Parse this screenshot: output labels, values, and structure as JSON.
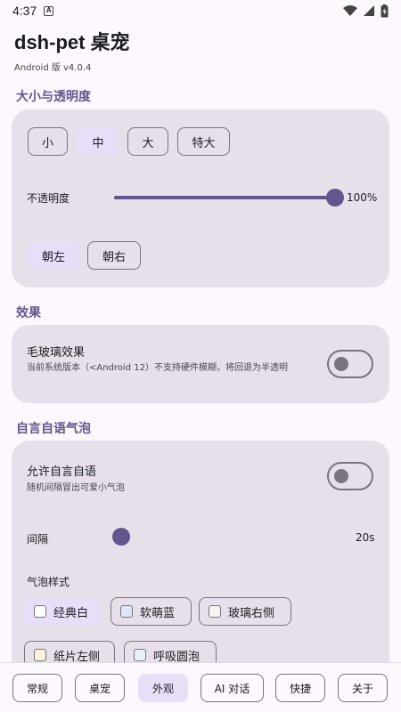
{
  "status": {
    "time": "4:37",
    "notif_glyph": "A"
  },
  "header": {
    "title": "dsh-pet 桌宠",
    "version": "Android 版 v4.0.4"
  },
  "size_section": {
    "title": "大小与透明度",
    "sizes": [
      "小",
      "中",
      "大",
      "特大"
    ],
    "selected_size": "中",
    "opacity_label": "不透明度",
    "opacity_value": "100%",
    "opacity_level": 1.0,
    "directions": [
      "朝左",
      "朝右"
    ],
    "selected_direction": "朝左"
  },
  "effect_section": {
    "title": "效果",
    "glass_label": "毛玻璃效果",
    "glass_desc": "当前系统版本（<Android 12）不支持硬件模糊，将回退为半透明",
    "glass_enabled": false
  },
  "bubble_section": {
    "title": "自言自语气泡",
    "allow_label": "允许自言自语",
    "allow_desc": "随机间隔冒出可爱小气泡",
    "allow_enabled": false,
    "interval_label": "间隔",
    "interval_value": "20s",
    "interval_level": 0.0,
    "style_label": "气泡样式",
    "styles": [
      {
        "label": "经典白",
        "color": "#ffffff"
      },
      {
        "label": "软萌蓝",
        "color": "#dbe6f7"
      },
      {
        "label": "玻璃右侧",
        "color": "#f7f3f3"
      },
      {
        "label": "纸片左侧",
        "color": "#fbf3dc"
      },
      {
        "label": "呼吸圆泡",
        "color": "#e6f1fa"
      }
    ],
    "selected_style": "经典白"
  },
  "nav": {
    "items": [
      "常规",
      "桌宠",
      "外观",
      "AI 对话",
      "快捷",
      "关于"
    ],
    "selected": "外观"
  },
  "colors": {
    "accent": "#65558f",
    "card": "#e7e0eb",
    "selected": "#e8def8"
  }
}
